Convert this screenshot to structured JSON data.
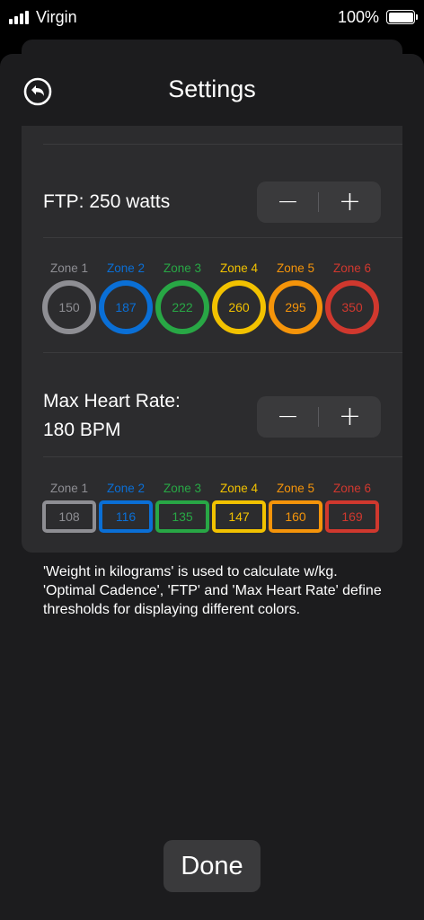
{
  "status_bar": {
    "carrier": "Virgin",
    "battery_percent": "100%"
  },
  "header": {
    "title": "Settings",
    "back_icon": "back-arrow-circle-icon"
  },
  "ftp": {
    "label": "FTP: 250 watts",
    "minus": "−",
    "plus": "+",
    "zones": [
      {
        "name": "Zone 1",
        "value": "150",
        "color": "#8e8e93"
      },
      {
        "name": "Zone 2",
        "value": "187",
        "color": "#0a6fd6"
      },
      {
        "name": "Zone 3",
        "value": "222",
        "color": "#28a745"
      },
      {
        "name": "Zone 4",
        "value": "260",
        "color": "#f2c200"
      },
      {
        "name": "Zone 5",
        "value": "295",
        "color": "#f5940a"
      },
      {
        "name": "Zone 6",
        "value": "350",
        "color": "#d0382e"
      }
    ]
  },
  "heart_rate": {
    "label_line1": "Max Heart Rate:",
    "label_line2": "180 BPM",
    "minus": "−",
    "plus": "+",
    "zones": [
      {
        "name": "Zone 1",
        "value": "108",
        "color": "#8e8e93"
      },
      {
        "name": "Zone 2",
        "value": "116",
        "color": "#0a6fd6"
      },
      {
        "name": "Zone 3",
        "value": "135",
        "color": "#28a745"
      },
      {
        "name": "Zone 4",
        "value": "147",
        "color": "#f2c200"
      },
      {
        "name": "Zone 5",
        "value": "160",
        "color": "#f5940a"
      },
      {
        "name": "Zone 6",
        "value": "169",
        "color": "#d0382e"
      }
    ]
  },
  "info_text": "'Weight in kilograms' is used to calculate w/kg. 'Optimal Cadence', 'FTP' and 'Max Heart Rate' define thresholds for displaying different colors.",
  "done_label": "Done"
}
